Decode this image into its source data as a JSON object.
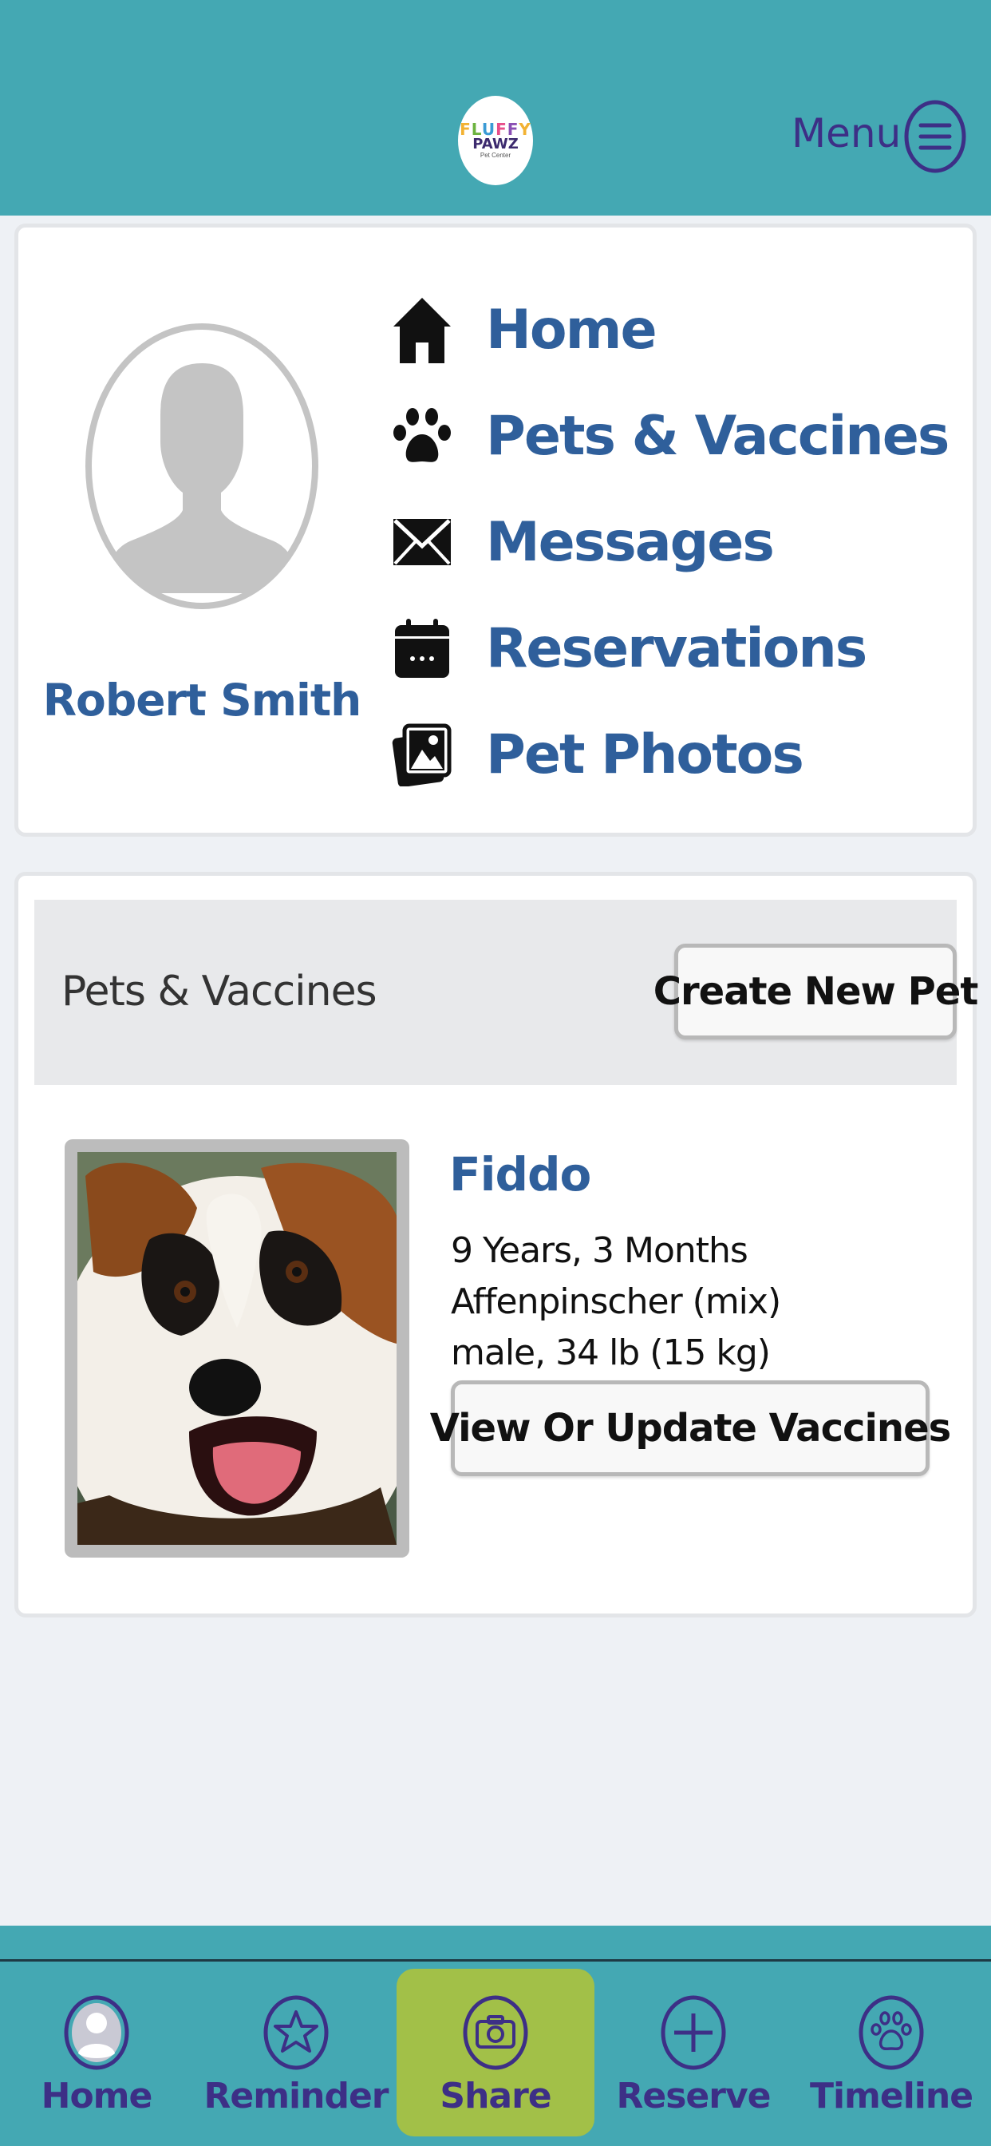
{
  "header": {
    "logo": {
      "line1": "FLUFFY",
      "line2": "PAWZ",
      "line3": "Pet Center"
    },
    "menu_label": "Menu",
    "menu_icon": "hamburger-circle-icon"
  },
  "profile": {
    "name": "Robert Smith",
    "avatar_icon": "default-avatar-icon",
    "nav": [
      {
        "label": "Home",
        "icon": "house-icon"
      },
      {
        "label": "Pets & Vaccines",
        "icon": "paw-icon"
      },
      {
        "label": "Messages",
        "icon": "envelope-icon"
      },
      {
        "label": "Reservations",
        "icon": "calendar-icon"
      },
      {
        "label": "Pet Photos",
        "icon": "photos-icon"
      }
    ]
  },
  "pets": {
    "title": "Pets & Vaccines",
    "create_button": "Create New Pet",
    "list": [
      {
        "name": "Fiddo",
        "age": "9 Years, 3 Months",
        "breed": "Affenpinscher (mix)",
        "sex_weight": "male, 34 lb (15 kg)",
        "vaccines_button": "View Or Update Vaccines"
      }
    ]
  },
  "bottom_nav": {
    "active": "Share",
    "tabs": [
      {
        "label": "Home",
        "icon": "person-circle-icon"
      },
      {
        "label": "Reminder",
        "icon": "star-circle-icon"
      },
      {
        "label": "Share",
        "icon": "camera-circle-icon"
      },
      {
        "label": "Reserve",
        "icon": "plus-circle-icon"
      },
      {
        "label": "Timeline",
        "icon": "paw-circle-icon"
      }
    ]
  },
  "colors": {
    "header_bg": "#44a8b3",
    "accent_text": "#2f5f9b",
    "nav_text": "#3d2f86",
    "active_tab": "#a2c048",
    "page_bg": "#eef1f5"
  }
}
